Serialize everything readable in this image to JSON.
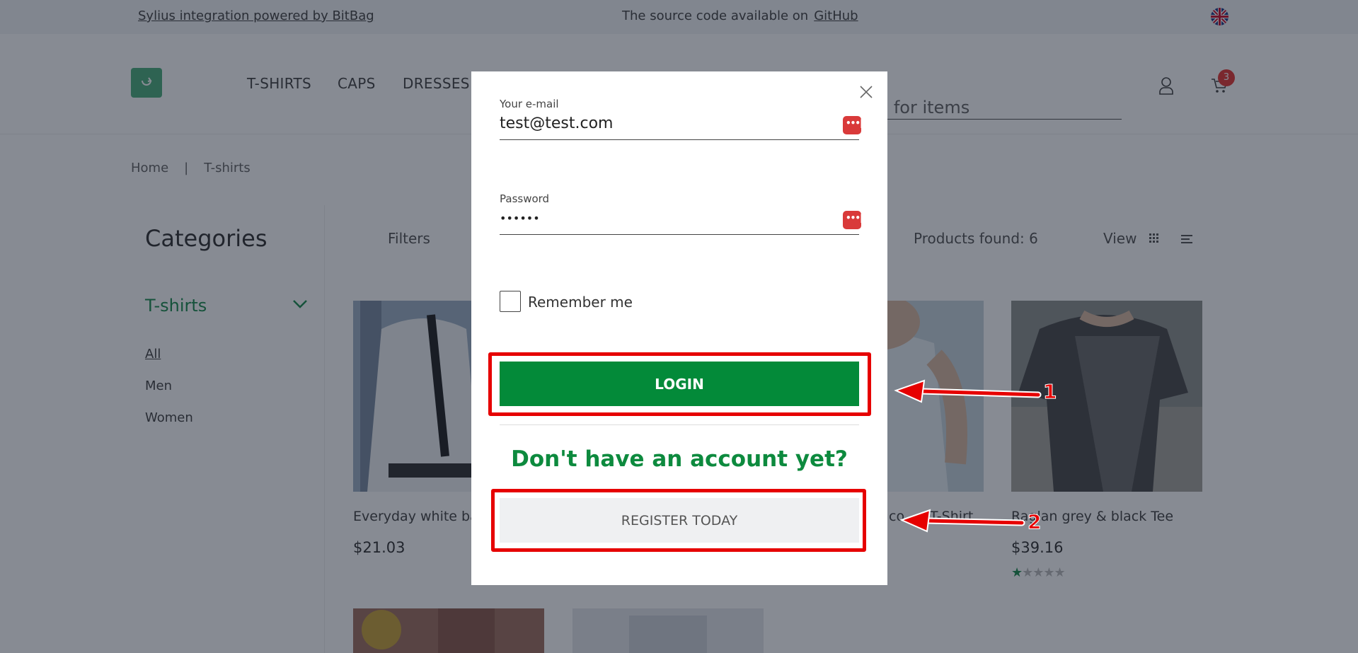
{
  "topbar": {
    "powered_by": "Sylius integration powered by BitBag",
    "source_text": "The source code available on",
    "github_link": "GitHub",
    "language_icon": "uk-flag-icon"
  },
  "header": {
    "nav": [
      "T-SHIRTS",
      "CAPS",
      "DRESSES"
    ],
    "search_placeholder": "Search for items",
    "search_visible": "h for items",
    "cart_count": "3"
  },
  "breadcrumb": {
    "home": "Home",
    "separator": "|",
    "current": "T-shirts"
  },
  "sidebar": {
    "title": "Categories",
    "main_category": "T-shirts",
    "items": [
      "All",
      "Men",
      "Women"
    ]
  },
  "toolbar": {
    "filters": "Filters",
    "products_found": "Products found:  6",
    "view": "View"
  },
  "products": [
    {
      "title": "Everyday white ba",
      "price": "$21.03"
    },
    {
      "title": "co...n T-Shirt",
      "price": ""
    },
    {
      "title": "Raglan grey & black Tee",
      "price": "$39.16",
      "rating": 1,
      "max_rating": 5
    }
  ],
  "modal": {
    "email_label": "Your e-mail",
    "email_value": "test@test.com",
    "password_label": "Password",
    "password_value": "••••••",
    "remember_label": "Remember me",
    "login_label": "LOGIN",
    "no_account_text": "Don't have an account yet?",
    "register_label": "REGISTER TODAY"
  },
  "annotations": {
    "login_number": "1",
    "register_number": "2"
  },
  "colors": {
    "accent_green": "#038a39",
    "annotation_red": "#e60000",
    "password_manager_red": "#d93a3a"
  }
}
